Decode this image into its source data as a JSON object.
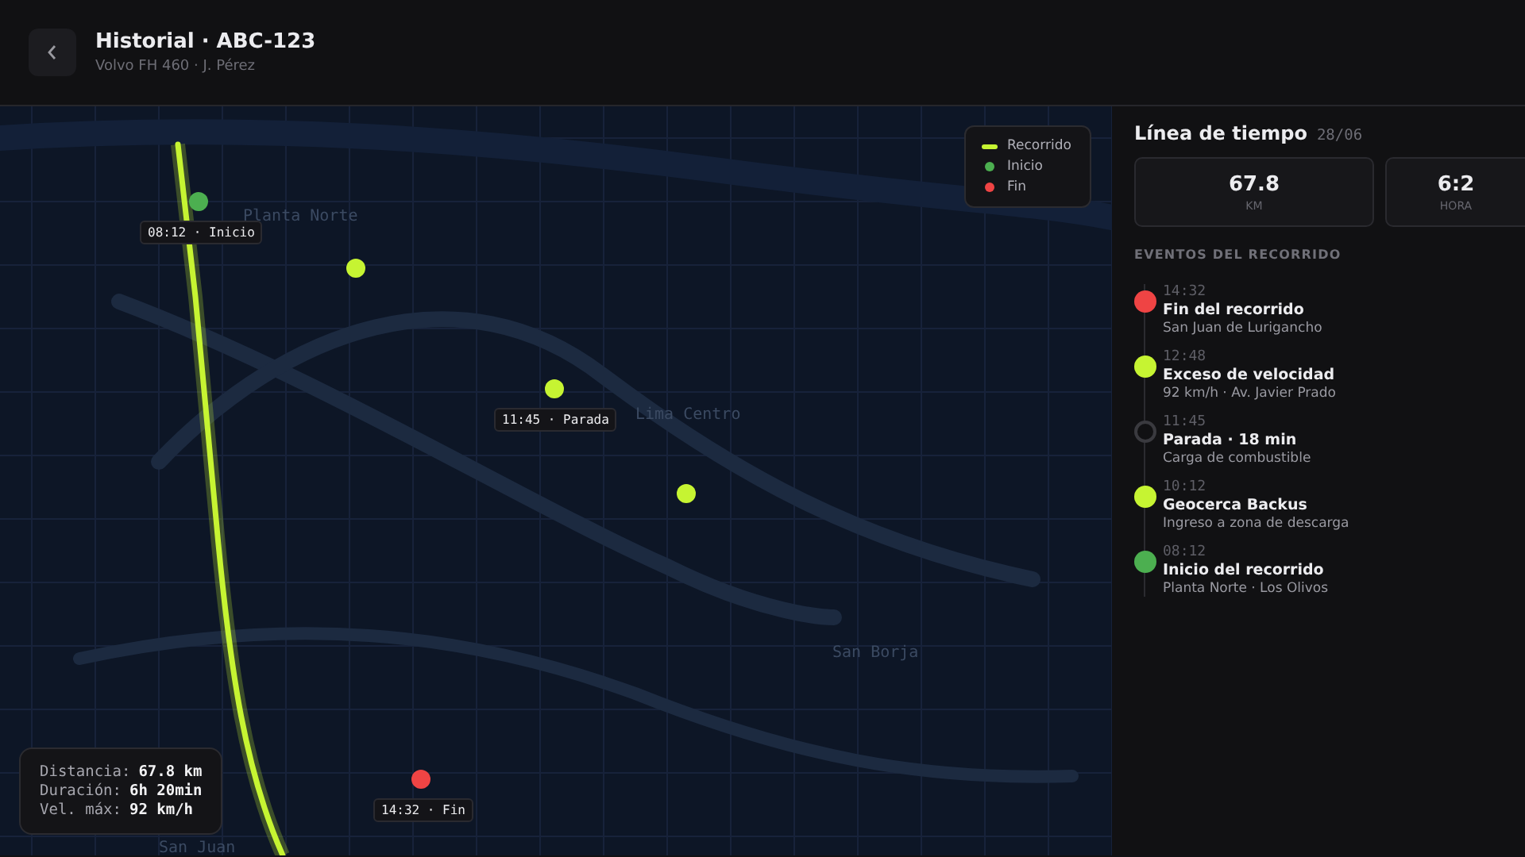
{
  "header": {
    "title": "Historial · ABC-123",
    "subtitle": "Volvo FH 460 · J. Pérez"
  },
  "map": {
    "places": [
      "Planta Norte",
      "Lima Centro",
      "San Borja",
      "San Juan"
    ],
    "markers": [
      {
        "color": "#4caf50",
        "label": "08:12 · Inicio"
      },
      {
        "color": "#c6f432"
      },
      {
        "color": "#c6f432",
        "label": "11:45 · Parada"
      },
      {
        "color": "#c6f432"
      },
      {
        "color": "#ef4444",
        "label": "14:32 · Fin"
      }
    ],
    "legend": [
      {
        "kind": "line",
        "color": "#c6f432",
        "label": "Recorrido"
      },
      {
        "kind": "dot",
        "color": "#4caf50",
        "label": "Inicio"
      },
      {
        "kind": "dot",
        "color": "#ef4444",
        "label": "Fin"
      }
    ],
    "summary": [
      {
        "label": "Distancia:",
        "value": "67.8 km"
      },
      {
        "label": "Duración:",
        "value": "6h 20min"
      },
      {
        "label": "Vel. máx:",
        "value": "92 km/h"
      }
    ]
  },
  "timeline": {
    "title": "Línea de tiempo",
    "date": "28/06",
    "stats": [
      {
        "value": "67.8",
        "unit": "KM"
      },
      {
        "value": "6:2",
        "unit": "HORA"
      }
    ],
    "section": "EVENTOS DEL RECORRIDO",
    "events": [
      {
        "kind": "filled",
        "color": "#ef4444",
        "time": "14:32",
        "title": "Fin del recorrido",
        "detail": "San Juan de Lurigancho"
      },
      {
        "kind": "filled",
        "color": "#c6f432",
        "time": "12:48",
        "title": "Exceso de velocidad",
        "detail": "92 km/h · Av. Javier Prado"
      },
      {
        "kind": "ring",
        "color": "#3a3a3f",
        "time": "11:45",
        "title": "Parada · 18 min",
        "detail": "Carga de combustible"
      },
      {
        "kind": "filled",
        "color": "#c6f432",
        "time": "10:12",
        "title": "Geocerca Backus",
        "detail": "Ingreso a zona de descarga"
      },
      {
        "kind": "filled",
        "color": "#4caf50",
        "time": "08:12",
        "title": "Inicio del recorrido",
        "detail": "Planta Norte · Los Olivos"
      }
    ]
  }
}
